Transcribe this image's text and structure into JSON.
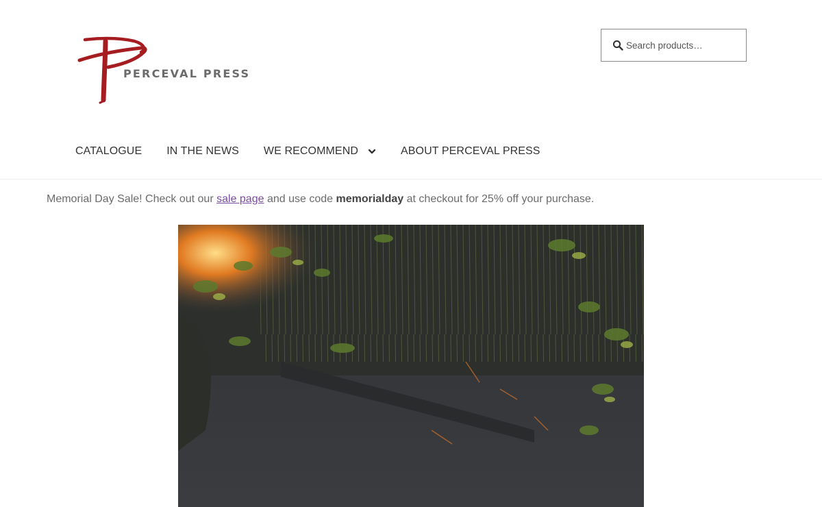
{
  "site": {
    "name": "PERCEVAL PRESS",
    "logo_icon": "perceval-press-logo"
  },
  "search": {
    "placeholder": "Search products…",
    "icon": "search-icon"
  },
  "nav": {
    "items": [
      {
        "label": "CATALOGUE"
      },
      {
        "label": "IN THE NEWS"
      },
      {
        "label": "WE RECOMMEND",
        "icon": "chevron-down-icon"
      },
      {
        "label": "ABOUT PERCEVAL PRESS"
      }
    ]
  },
  "promo": {
    "lead": "Memorial Day Sale! Check out our ",
    "link_text": "sale page",
    "middle": " and use code ",
    "code": "memorialday",
    "tail": " at checkout for 25% off your purchase."
  },
  "colors": {
    "logo_red": "#a51d21",
    "link_purple": "#7b4ba0",
    "text_gray": "#6b6b6b"
  }
}
